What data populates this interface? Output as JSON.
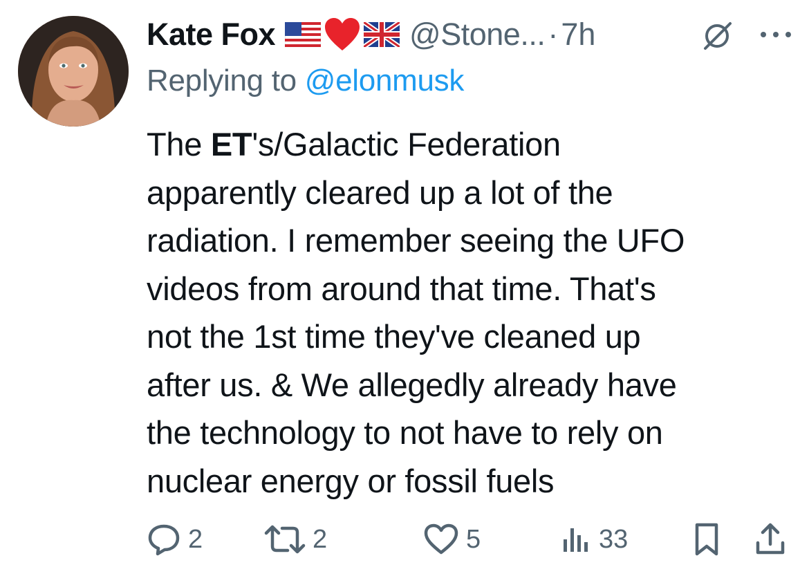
{
  "tweet": {
    "author_name": "Kate Fox",
    "author_emojis": [
      "us-flag-icon",
      "red-heart-icon",
      "uk-flag-icon"
    ],
    "handle": "@Stone...",
    "separator": "·",
    "time": "7h",
    "replying_prefix": "Replying to ",
    "replying_to": "@elonmusk",
    "body": {
      "l1_pre": "The ",
      "l1_bold": "ET",
      "l1_post": "'s/Galactic Federation",
      "l2": "apparently cleared up a lot of the",
      "l3": "radiation. I remember seeing the UFO",
      "l4": "videos from around that time. That's",
      "l5": "not the 1st time they've cleaned up",
      "l6": "after us. & We allegedly already have",
      "l7": "the technology to not have to rely on",
      "l8": "nuclear energy or fossil fuels"
    },
    "actions": {
      "replies": "2",
      "reposts": "2",
      "likes": "5",
      "views": "33"
    }
  },
  "colors": {
    "text": "#0f1419",
    "secondary": "#536471",
    "link": "#1d9bf0"
  }
}
